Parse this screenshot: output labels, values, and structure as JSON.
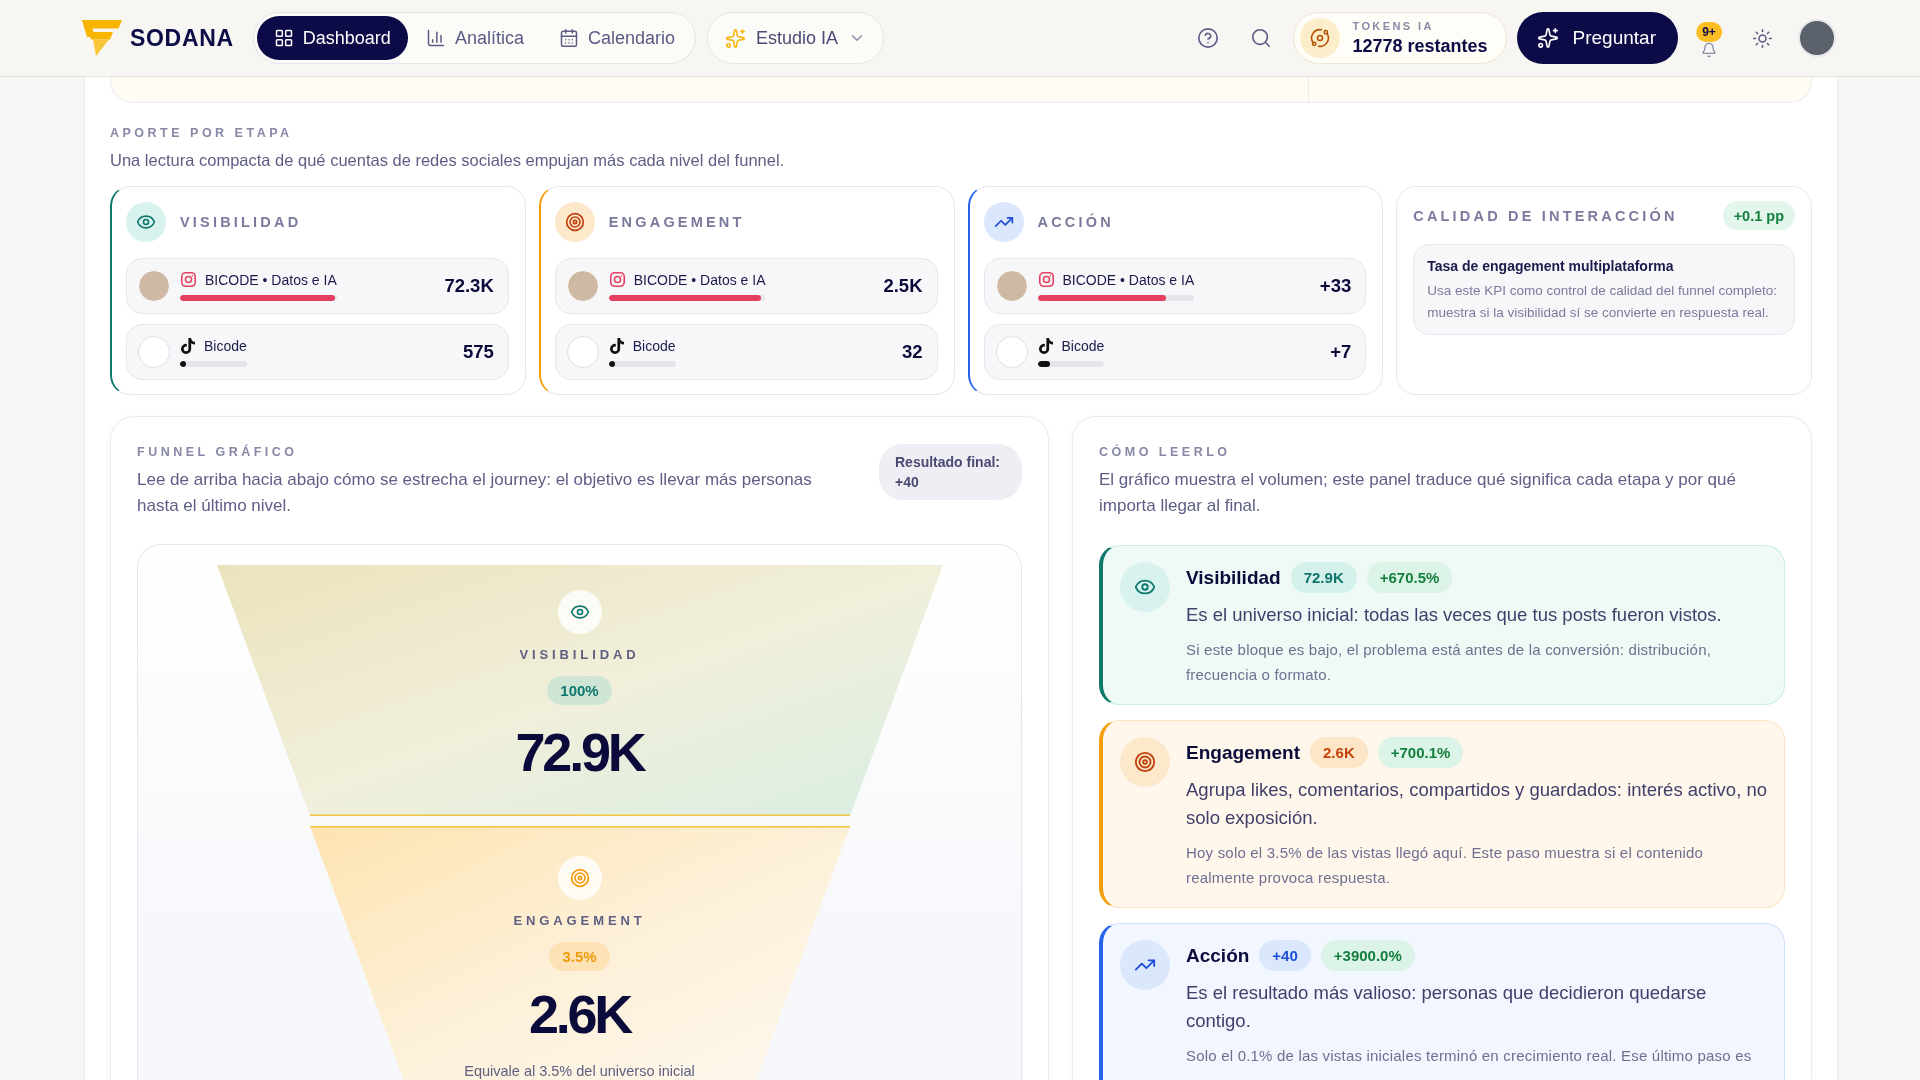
{
  "header": {
    "brand": "SODANA",
    "nav": [
      {
        "label": "Dashboard",
        "selected": true
      },
      {
        "label": "Analítica",
        "selected": false
      },
      {
        "label": "Calendario",
        "selected": false
      }
    ],
    "studio_menu": {
      "label": "Estudio IA"
    },
    "tokens": {
      "label": "TOKENS IA",
      "value": "12778 restantes"
    },
    "ask_button": {
      "label": "Preguntar"
    },
    "notifications": {
      "badge": "9+"
    }
  },
  "contribution": {
    "title": "APORTE POR ETAPA",
    "subtitle": "Una lectura compacta de qué cuentas de redes sociales empujan más cada nivel del funnel.",
    "stages": [
      {
        "kind": "visibility",
        "label": "VISIBILIDAD",
        "accounts": [
          {
            "kind": "instagram",
            "name": "BICODE • Datos e IA",
            "level": 0.99,
            "value": "72.3K"
          },
          {
            "kind": "tiktok",
            "name": "Bicode",
            "level": 0.01,
            "value": "575"
          }
        ]
      },
      {
        "kind": "engagement",
        "label": "ENGAGEMENT",
        "accounts": [
          {
            "kind": "instagram",
            "name": "BICODE • Datos e IA",
            "level": 0.97,
            "value": "2.5K"
          },
          {
            "kind": "tiktok",
            "name": "Bicode",
            "level": 0.01,
            "value": "32"
          }
        ]
      },
      {
        "kind": "action",
        "label": "ACCIÓN",
        "accounts": [
          {
            "kind": "instagram",
            "name": "BICODE • Datos e IA",
            "level": 0.82,
            "value": "+33"
          },
          {
            "kind": "tiktok",
            "name": "Bicode",
            "level": 0.18,
            "value": "+7"
          }
        ]
      }
    ],
    "quality": {
      "title": "CALIDAD DE INTERACCIÓN",
      "badge": "+0.1 pp",
      "metric": "Tasa de engagement multiplataforma",
      "description": "Usa este KPI como control de calidad del funnel completo: muestra si la visibilidad sí se convierte en respuesta real."
    }
  },
  "funnel": {
    "title": "FUNNEL GRÁFICO",
    "description": "Lee de arriba hacia abajo cómo se estrecha el journey: el objetivo es llevar más personas hasta el último nivel.",
    "result": "Resultado final: +40",
    "layers": [
      {
        "kind": "visibility",
        "label": "VISIBILIDAD",
        "share": "100%",
        "value": "72.9K"
      },
      {
        "kind": "engagement",
        "label": "ENGAGEMENT",
        "share": "3.5%",
        "value": "2.6K",
        "note": "Equivale al 3.5% del universo inicial"
      }
    ]
  },
  "guide": {
    "title": "CÓMO LEERLO",
    "description": "El gráfico muestra el volumen; este panel traduce qué significa cada etapa y por qué importa llegar al final.",
    "stages": [
      {
        "kind": "visibility",
        "title": "Visibilidad",
        "value": "72.9K",
        "change": "+670.5%",
        "summary": "Es el universo inicial: todas las veces que tus posts fueron vistos.",
        "note": "Si este bloque es bajo, el problema está antes de la conversión: distribución, frecuencia o formato."
      },
      {
        "kind": "engagement",
        "title": "Engagement",
        "value": "2.6K",
        "change": "+700.1%",
        "summary": "Agrupa likes, comentarios, compartidos y guardados: interés activo, no solo exposición.",
        "note": "Hoy solo el 3.5% de las vistas llegó aquí. Este paso muestra si el contenido realmente provoca respuesta."
      },
      {
        "kind": "action",
        "title": "Acción",
        "value": "+40",
        "change": "+3900.0%",
        "summary": "Es el resultado más valioso: personas que decidieron quedarse contigo.",
        "note": "Solo el 0.1% de las vistas iniciales terminó en crecimiento real. Ese último paso es"
      }
    ]
  }
}
